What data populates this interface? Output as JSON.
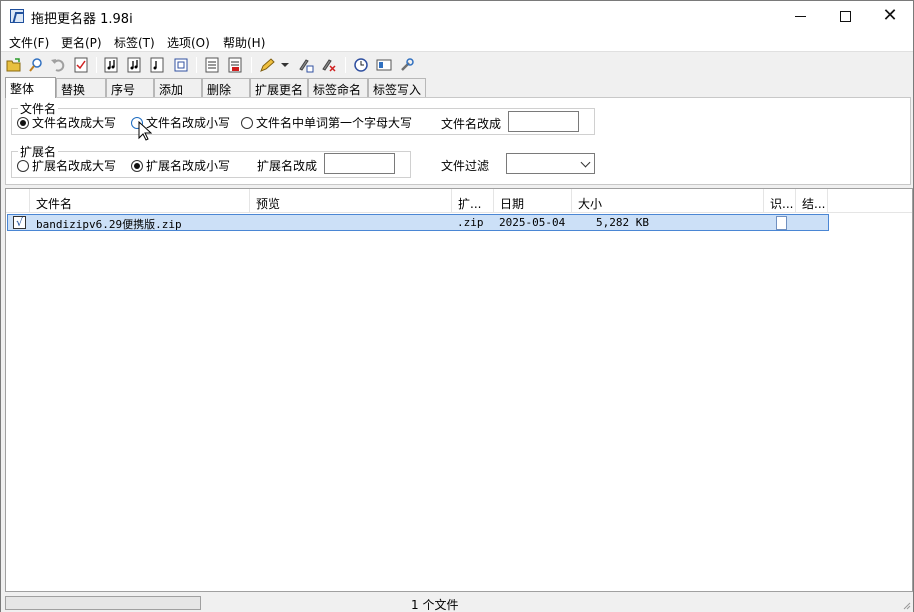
{
  "window": {
    "title": "拖把更名器 1.98i"
  },
  "menu": [
    "文件(F)",
    "更名(P)",
    "标签(T)",
    "选项(O)",
    "帮助(H)"
  ],
  "toolbar": {
    "icons": [
      "open-folder-icon",
      "search-icon",
      "undo-icon",
      "checklist-icon",
      "music-note-icon",
      "music-note-icon",
      "music-note-icon",
      "tag-icon",
      "document-icon",
      "document-red-icon",
      "pencil-icon",
      "dropdown-arrow-icon",
      "rename-tag-icon",
      "rename-clear-icon",
      "clock-icon",
      "panel-icon",
      "tools-icon"
    ]
  },
  "tabs": [
    "整体",
    "替换",
    "序号",
    "添加",
    "删除",
    "扩展更名",
    "标签命名",
    "标签写入"
  ],
  "filename_group": {
    "label": "文件名",
    "options": [
      "文件名改成大写",
      "文件名改成小写",
      "文件名中单词第一个字母大写"
    ],
    "rename_to_label": "文件名改成",
    "rename_to_value": ""
  },
  "extension_group": {
    "label": "扩展名",
    "options": [
      "扩展名改成大写",
      "扩展名改成小写"
    ],
    "rename_to_label": "扩展名改成",
    "rename_to_value": ""
  },
  "filter": {
    "label": "文件过滤",
    "value": ""
  },
  "columns": [
    "文件名",
    "预览",
    "扩...",
    "日期",
    "大小",
    "识...",
    "结..."
  ],
  "files": [
    {
      "checked": "√",
      "name": "bandizipv6.29便携版.zip",
      "preview": "",
      "ext": ".zip",
      "date": "2025-05-04",
      "size": "5,282 KB"
    }
  ],
  "status": {
    "text": "1 个文件"
  }
}
